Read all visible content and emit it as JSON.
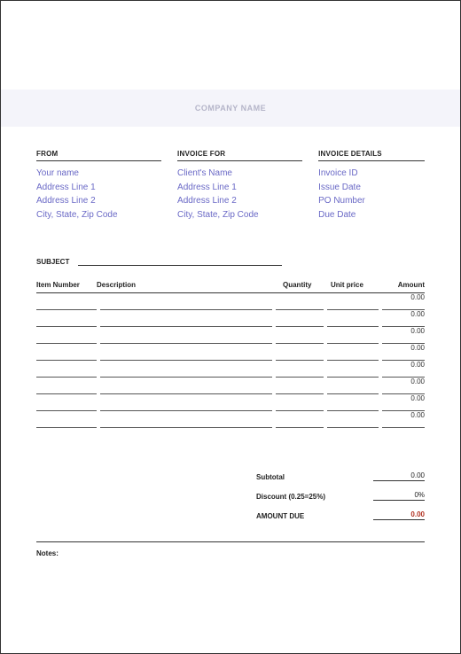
{
  "company_name": "COMPANY NAME",
  "from": {
    "heading": "FROM",
    "name": "Your name",
    "address1": "Address Line 1",
    "address2": "Address Line 2",
    "city": "City, State, Zip Code"
  },
  "invoice_for": {
    "heading": "INVOICE FOR",
    "name": "Client's Name",
    "address1": "Address Line 1",
    "address2": "Address Line 2",
    "city": "City, State, Zip Code"
  },
  "details": {
    "heading": "INVOICE DETAILS",
    "invoice_id": "Invoice ID",
    "issue_date": "Issue Date",
    "po_number": "PO Number",
    "due_date": "Due Date"
  },
  "subject_label": "SUBJECT",
  "table": {
    "headers": {
      "item": "Item Number",
      "desc": "Description",
      "qty": "Quantity",
      "unit": "Unit price",
      "amt": "Amount"
    },
    "rows": [
      {
        "amount": "0.00"
      },
      {
        "amount": "0.00"
      },
      {
        "amount": "0.00"
      },
      {
        "amount": "0.00"
      },
      {
        "amount": "0.00"
      },
      {
        "amount": "0.00"
      },
      {
        "amount": "0.00"
      },
      {
        "amount": "0.00"
      }
    ]
  },
  "totals": {
    "subtotal_label": "Subtotal",
    "subtotal_value": "0.00",
    "discount_label": "Discount (0.25=25%)",
    "discount_value": "0%",
    "due_label": "AMOUNT DUE",
    "due_value": "0.00"
  },
  "notes_label": "Notes:"
}
